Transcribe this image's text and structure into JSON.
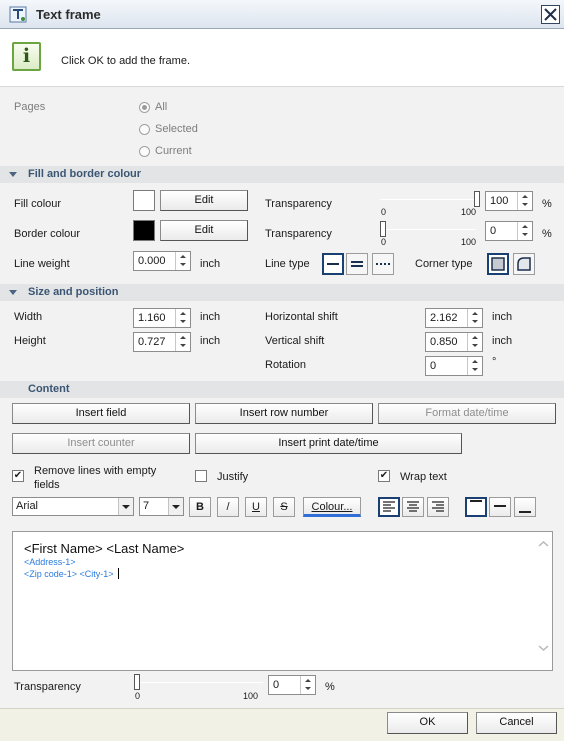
{
  "window": {
    "title": "Text frame"
  },
  "info": {
    "message": "Click OK to add the frame."
  },
  "pages": {
    "label": "Pages",
    "options": [
      {
        "label": "All",
        "selected": true
      },
      {
        "label": "Selected",
        "selected": false
      },
      {
        "label": "Current",
        "selected": false
      }
    ]
  },
  "fill_border": {
    "header": "Fill and border colour",
    "fill_label": "Fill colour",
    "fill_color": "#ffffff",
    "fill_edit": "Edit",
    "border_label": "Border colour",
    "border_color": "#000000",
    "border_edit": "Edit",
    "transparency_label": "Transparency",
    "fill_transparency": {
      "value": "100",
      "min": "0",
      "max": "100",
      "unit": "%"
    },
    "border_transparency": {
      "value": "0",
      "min": "0",
      "max": "100",
      "unit": "%"
    },
    "line_weight_label": "Line weight",
    "line_weight": "0.000",
    "line_weight_unit": "inch",
    "line_type_label": "Line type",
    "corner_type_label": "Corner type"
  },
  "size_position": {
    "header": "Size and position",
    "width_label": "Width",
    "width": "1.160",
    "height_label": "Height",
    "height": "0.727",
    "hshift_label": "Horizontal shift",
    "hshift": "2.162",
    "vshift_label": "Vertical shift",
    "vshift": "0.850",
    "rotation_label": "Rotation",
    "rotation": "0",
    "rotation_unit": "°",
    "unit": "inch"
  },
  "content": {
    "header": "Content",
    "insert_field": "Insert field",
    "insert_row_number": "Insert row number",
    "format_datetime": "Format date/time",
    "insert_counter": "Insert counter",
    "insert_print_datetime": "Insert print date/time",
    "remove_lines": "Remove lines with empty fields",
    "remove_lines_line1": "Remove lines with empty",
    "remove_lines_line2": "fields",
    "remove_lines_checked": true,
    "justify": "Justify",
    "justify_checked": false,
    "wrap_text": "Wrap text",
    "wrap_text_checked": true
  },
  "toolbar": {
    "font": "Arial",
    "size": "7",
    "bold": "B",
    "italic": "/",
    "underline": "U",
    "strike": "S",
    "colour": "Colour...",
    "colour_color": "#2f6fd6"
  },
  "editor": {
    "line1": "<First Name> <Last Name>",
    "line2": "<Address-1>",
    "line3": "<Zip code-1> <City-1>",
    "field_color": "#2a7be0"
  },
  "bottom_transparency": {
    "label": "Transparency",
    "value": "0",
    "min": "0",
    "max": "100",
    "unit": "%"
  },
  "buttons": {
    "ok": "OK",
    "cancel": "Cancel"
  }
}
